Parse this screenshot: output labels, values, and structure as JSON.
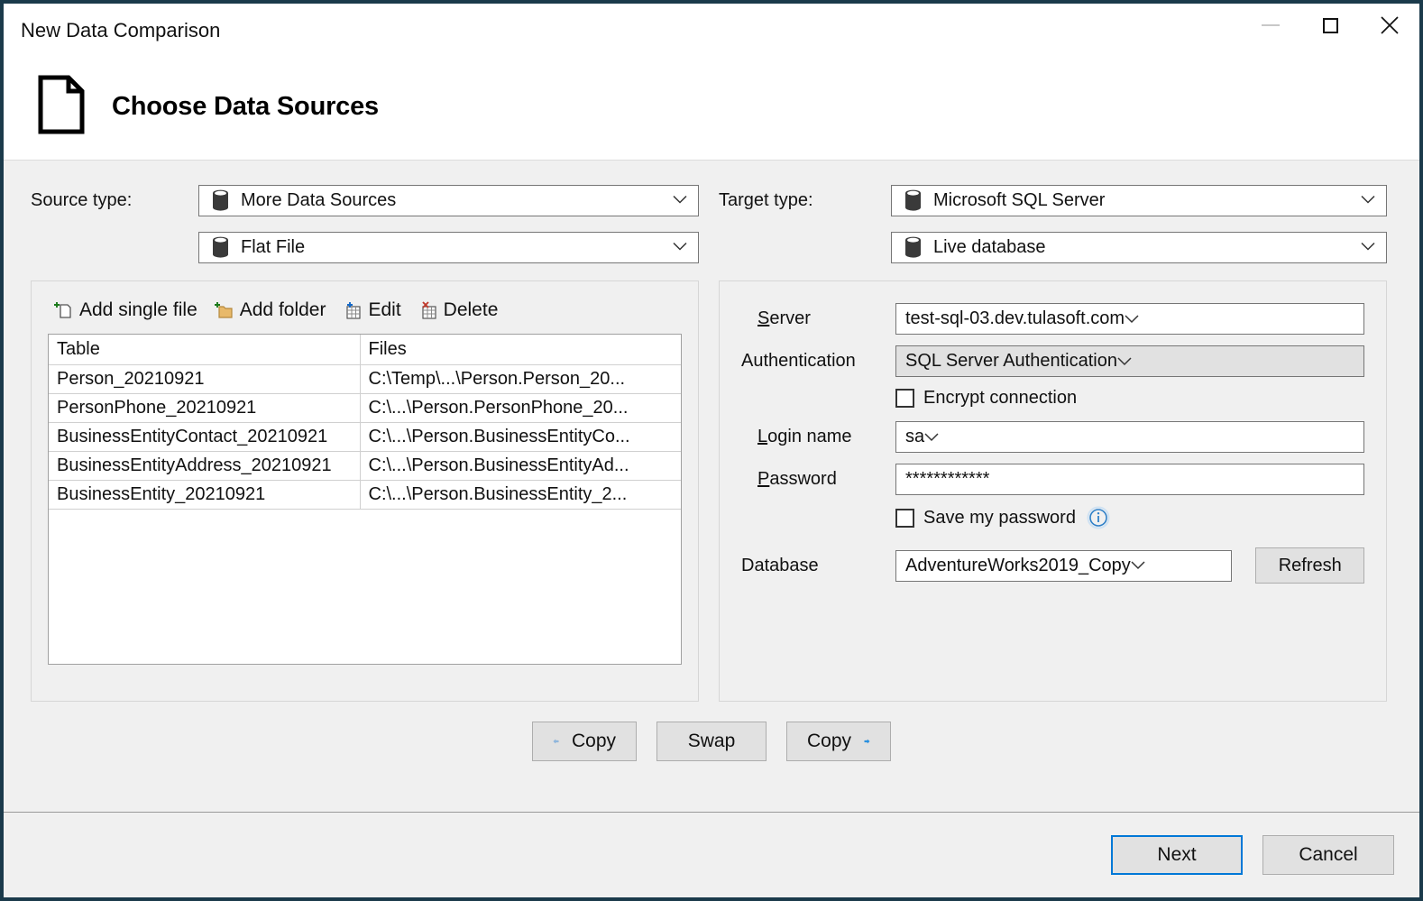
{
  "window": {
    "title": "New Data Comparison",
    "minimize_icon": "minimize-icon",
    "maximize_icon": "maximize-icon",
    "close_icon": "close-icon"
  },
  "header": {
    "title": "Choose Data Sources",
    "icon": "document-page-icon"
  },
  "source": {
    "type_label": "Source type:",
    "provider": "More Data Sources",
    "subtype": "Flat File",
    "provider_icon": "database-icon",
    "subtype_icon": "database-icon",
    "toolbar": [
      {
        "label": "Add single file",
        "icon": "add-file-icon"
      },
      {
        "label": "Add folder",
        "icon": "add-folder-icon"
      },
      {
        "label": "Edit",
        "icon": "edit-table-icon"
      },
      {
        "label": "Delete",
        "icon": "delete-table-icon"
      }
    ],
    "table": {
      "columns": [
        "Table",
        "Files"
      ],
      "rows": [
        [
          "Person_20210921",
          "C:\\Temp\\...\\Person.Person_20..."
        ],
        [
          "PersonPhone_20210921",
          "C:\\...\\Person.PersonPhone_20..."
        ],
        [
          "BusinessEntityContact_20210921",
          "C:\\...\\Person.BusinessEntityCo..."
        ],
        [
          "BusinessEntityAddress_20210921",
          "C:\\...\\Person.BusinessEntityAd..."
        ],
        [
          "BusinessEntity_20210921",
          "C:\\...\\Person.BusinessEntity_2..."
        ]
      ]
    }
  },
  "target": {
    "type_label": "Target type:",
    "provider": "Microsoft SQL Server",
    "subtype": "Live database",
    "provider_icon": "database-icon",
    "subtype_icon": "database-icon",
    "server_label": "Server",
    "server_label_accel": "S",
    "server_label_rest": "erver",
    "server_value": "test-sql-03.dev.tulasoft.com",
    "auth_label": "Authentication",
    "auth_value": "SQL Server Authentication",
    "encrypt_label": "Encrypt connection",
    "encrypt_checked": false,
    "login_label_accel": "L",
    "login_label_rest": "ogin name",
    "login_value": "sa",
    "password_label_accel": "P",
    "password_label_rest": "assword",
    "password_value": "************",
    "save_password_label": "Save my password",
    "save_password_checked": false,
    "info_icon": "info-icon",
    "database_label": "Database",
    "database_value": "AdventureWorks2019_Copy",
    "refresh_label": "Refresh"
  },
  "middle_actions": {
    "copy_left_label": "Copy",
    "copy_left_icon": "arrow-left-icon",
    "swap_label": "Swap",
    "copy_right_label": "Copy",
    "copy_right_icon": "arrow-right-icon"
  },
  "footer": {
    "next_label": "Next",
    "cancel_label": "Cancel"
  },
  "colors": {
    "window_border": "#1b3a4b",
    "accent_blue": "#0078d7",
    "arrow_right": "#1e90e8",
    "arrow_left": "#8fb8e0",
    "dialog_bg": "#f0f0f0"
  }
}
